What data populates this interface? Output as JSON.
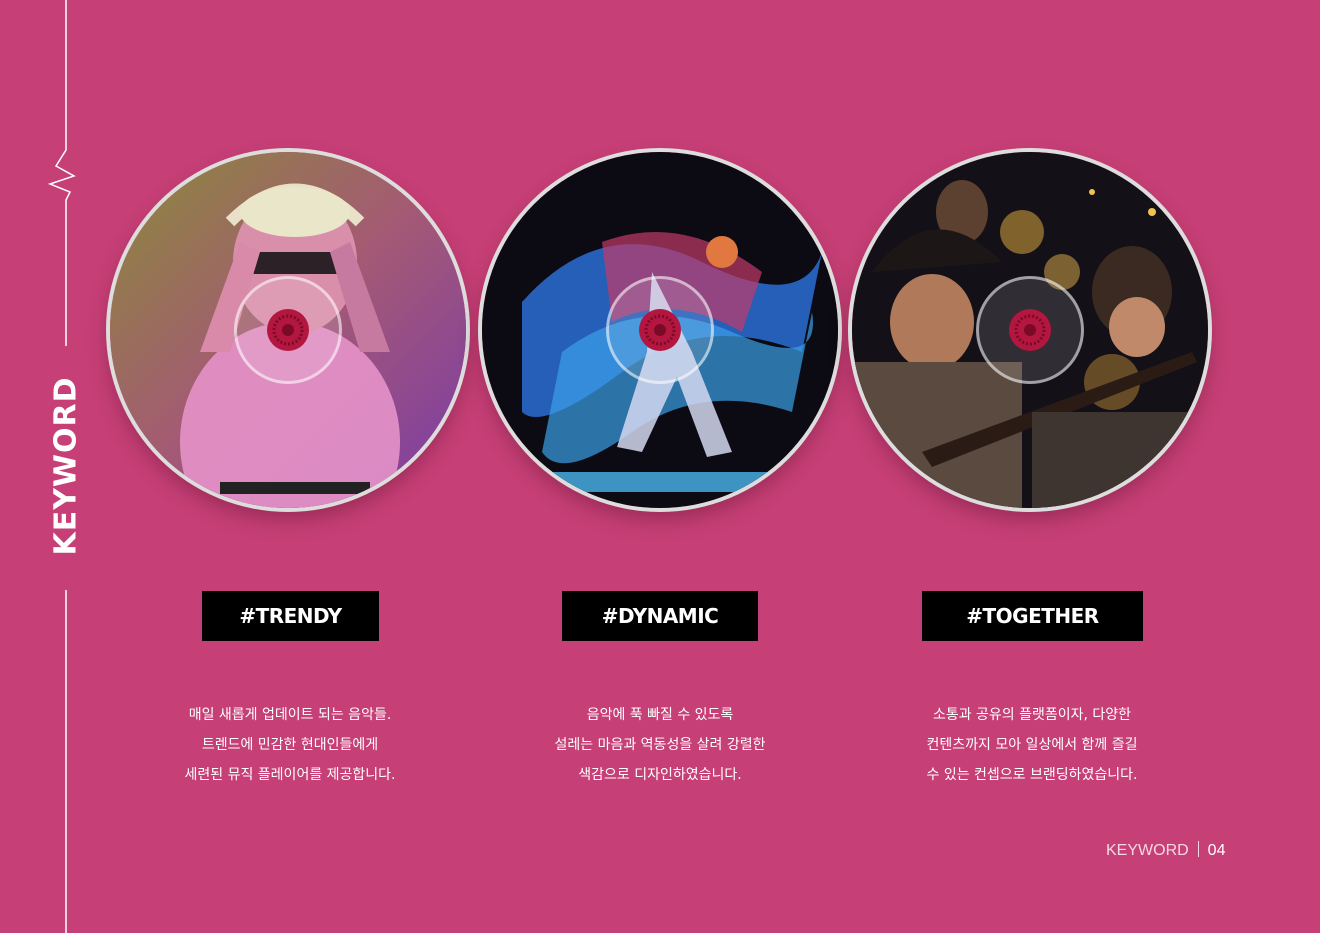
{
  "sidebar": {
    "title": "KEYWORD"
  },
  "keywords": [
    {
      "tag": "#TRENDY",
      "photo": "woman-with-headphones-photo",
      "lines": [
        "매일 새롭게 업데이트 되는 음악들.",
        "트렌드에 민감한 현대인들에게",
        "세련된 뮤직 플레이어를 제공합니다."
      ]
    },
    {
      "tag": "#DYNAMIC",
      "photo": "dancer-motion-photo",
      "lines": [
        "음악에 푹 빠질 수 있도록",
        "설레는 마음과 역동성을 살려 강렬한",
        "색감으로 디자인하였습니다."
      ]
    },
    {
      "tag": "#TOGETHER",
      "photo": "band-playing-guitar-photo",
      "lines": [
        "소통과 공유의 플랫폼이자, 다양한",
        "컨텐츠까지 모아 일상에서 함께 즐길",
        "수 있는 컨셉으로 브랜딩하였습니다."
      ]
    }
  ],
  "footer": {
    "label": "KEYWORD",
    "page": "04"
  },
  "colors": {
    "background": "#c63f76",
    "tag_bg": "#000000",
    "hub": "#b3163f"
  }
}
